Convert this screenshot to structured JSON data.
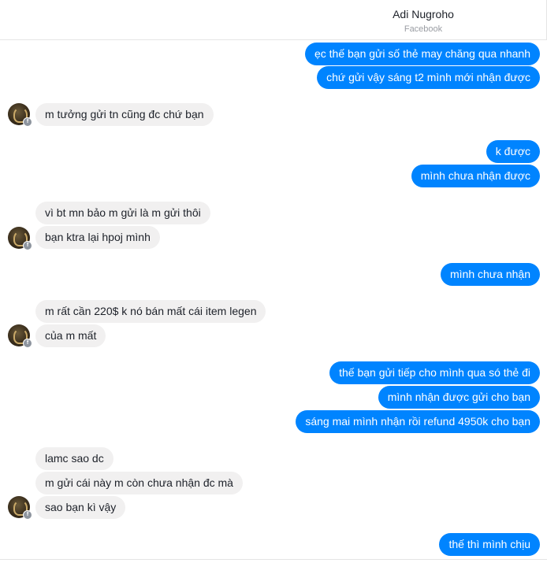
{
  "header": {
    "name": "Adi Nugroho",
    "subtitle": "Facebook"
  },
  "avatar": {
    "icon": "profile-avatar-icon",
    "badge_icon": "facebook-icon",
    "badge_label": "f"
  },
  "colors": {
    "outgoing": "#0084ff",
    "incoming": "#f1f0f0"
  },
  "messages": [
    {
      "text": "ẹc thế bạn gửi số thẻ may chăng qua nhanh",
      "from": "me"
    },
    {
      "text": "chứ gửi vậy sáng t2 mình mới nhận được",
      "from": "me"
    },
    {
      "text": "m tưởng gửi tn cũng đc chứ bạn",
      "from": "them"
    },
    {
      "text": "k được",
      "from": "me"
    },
    {
      "text": "mình chưa nhận được",
      "from": "me"
    },
    {
      "text": "vì bt mn bảo m gửi là m gửi thôi",
      "from": "them"
    },
    {
      "text": "bạn ktra lại hpoj mình",
      "from": "them"
    },
    {
      "text": "mình chưa nhận",
      "from": "me"
    },
    {
      "text": "m rất cần 220$ k nó bán mất cái item legen",
      "from": "them"
    },
    {
      "text": "của m mất",
      "from": "them"
    },
    {
      "text": "thế bạn gửi tiếp cho mình qua só thẻ đi",
      "from": "me"
    },
    {
      "text": "mình nhận được gửi cho bạn",
      "from": "me"
    },
    {
      "text": "sáng mai mình nhận rồi refund 4950k cho bạn",
      "from": "me"
    },
    {
      "text": "lamc sao dc",
      "from": "them"
    },
    {
      "text": "m gửi cái này m còn chưa nhận đc mà",
      "from": "them"
    },
    {
      "text": "sao bạn kì vậy",
      "from": "them"
    },
    {
      "text": "thế thì mình chịu",
      "from": "me"
    }
  ]
}
